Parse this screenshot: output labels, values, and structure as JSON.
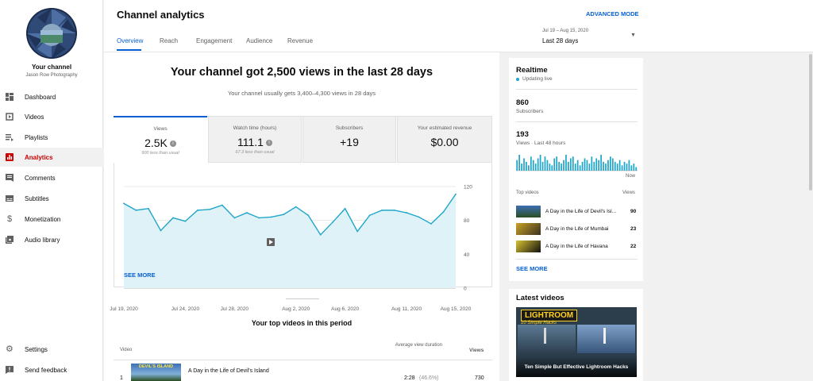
{
  "sidebar": {
    "channel_label": "Your channel",
    "channel_name": "Jason Row Photography",
    "items": [
      {
        "label": "Dashboard",
        "icon": "dashboard-icon"
      },
      {
        "label": "Videos",
        "icon": "videos-icon"
      },
      {
        "label": "Playlists",
        "icon": "playlists-icon"
      },
      {
        "label": "Analytics",
        "icon": "analytics-icon"
      },
      {
        "label": "Comments",
        "icon": "comments-icon"
      },
      {
        "label": "Subtitles",
        "icon": "subtitles-icon"
      },
      {
        "label": "Monetization",
        "icon": "dollar-icon"
      },
      {
        "label": "Audio library",
        "icon": "audio-library-icon"
      }
    ],
    "active": "Analytics",
    "settings_label": "Settings",
    "feedback_label": "Send feedback"
  },
  "header": {
    "title": "Channel analytics",
    "advanced_mode": "ADVANCED MODE",
    "tabs": [
      "Overview",
      "Reach",
      "Engagement",
      "Audience",
      "Revenue"
    ],
    "active_tab": "Overview",
    "date_range": "Jul 19 – Aug 15, 2020",
    "period": "Last 28 days"
  },
  "overview": {
    "headline": "Your channel got 2,500 views in the last 28 days",
    "subline": "Your channel usually gets 3,400–4,300 views in 28 days",
    "metrics": [
      {
        "label": "Views",
        "value": "2.5K",
        "sub": "900 less than usual"
      },
      {
        "label": "Watch time (hours)",
        "value": "111.1",
        "sub": "67.3 less than usual"
      },
      {
        "label": "Subscribers",
        "value": "+19",
        "sub": ""
      },
      {
        "label": "Your estimated revenue",
        "value": "$0.00",
        "sub": ""
      }
    ],
    "see_more": "SEE MORE",
    "top_videos_title": "Your top videos in this period",
    "table_headers": {
      "video": "Video",
      "avd": "Average view duration",
      "views": "Views"
    },
    "top_rows": [
      {
        "rank": "1",
        "title": "A Day in the Life of Devil's Island",
        "thumb_text": "DEVIL'S ISLAND",
        "duration": "2:28",
        "pct": "(46.6%)",
        "views": "730"
      }
    ]
  },
  "chart_data": {
    "type": "line",
    "x": [
      "Jul 19, 2020",
      "Jul 20, 2020",
      "Jul 21, 2020",
      "Jul 22, 2020",
      "Jul 23, 2020",
      "Jul 24, 2020",
      "Jul 25, 2020",
      "Jul 26, 2020",
      "Jul 27, 2020",
      "Jul 28, 2020",
      "Jul 29, 2020",
      "Jul 30, 2020",
      "Jul 31, 2020",
      "Aug 1, 2020",
      "Aug 2, 2020",
      "Aug 3, 2020",
      "Aug 4, 2020",
      "Aug 5, 2020",
      "Aug 6, 2020",
      "Aug 7, 2020",
      "Aug 8, 2020",
      "Aug 9, 2020",
      "Aug 10, 2020",
      "Aug 11, 2020",
      "Aug 12, 2020",
      "Aug 13, 2020",
      "Aug 14, 2020",
      "Aug 15, 2020"
    ],
    "series": [
      {
        "values": [
          100,
          92,
          94,
          68,
          83,
          79,
          92,
          93,
          98,
          83,
          89,
          83,
          84,
          87,
          96,
          86,
          63,
          78,
          94,
          67,
          86,
          92,
          92,
          89,
          84,
          76,
          90,
          111
        ]
      }
    ],
    "xticks": [
      "Jul 19, 2020",
      "Jul 24, 2020",
      "Jul 28, 2020",
      "Aug 2, 2020",
      "Aug 6, 2020",
      "Aug 11, 2020",
      "Aug 15, 2020"
    ],
    "yticks": [
      "120",
      "80",
      "40",
      "0"
    ],
    "ylim": [
      0,
      120
    ],
    "grid": true,
    "line_color": "#20a6c8",
    "fill_color": "#dff2f8"
  },
  "realtime": {
    "title": "Realtime",
    "status": "Updating live",
    "subs_value": "860",
    "subs_label": "Subscribers",
    "views_value": "193",
    "views_label": "Views · Last 48 hours",
    "now_label": "Now",
    "bars": [
      6,
      9,
      4,
      7,
      5,
      3,
      8,
      6,
      4,
      7,
      9,
      5,
      8,
      6,
      4,
      3,
      7,
      8,
      5,
      4,
      6,
      9,
      5,
      7,
      8,
      4,
      6,
      3,
      5,
      7,
      6,
      4,
      8,
      5,
      7,
      6,
      9,
      5,
      4,
      6,
      8,
      7,
      5,
      4,
      6,
      3,
      5,
      4,
      6,
      3,
      4,
      2
    ],
    "top_label": "Top videos",
    "views_col": "Views",
    "videos": [
      {
        "title": "A Day in the Life of Devil's Isl...",
        "views": "90"
      },
      {
        "title": "A Day in the Life of Mumbai",
        "views": "23"
      },
      {
        "title": "A Day in the Life of Havana",
        "views": "22"
      }
    ],
    "see_more": "SEE MORE"
  },
  "latest": {
    "title": "Latest videos",
    "thumb_title": "LIGHTROOM",
    "thumb_sub": "10 Simple Hacks",
    "video_title": "Ten Simple But Effective Lightroom Hacks"
  },
  "colors": {
    "accent": "#065fd4",
    "active_nav": "#cc0000",
    "chart_line": "#20a6c8"
  }
}
